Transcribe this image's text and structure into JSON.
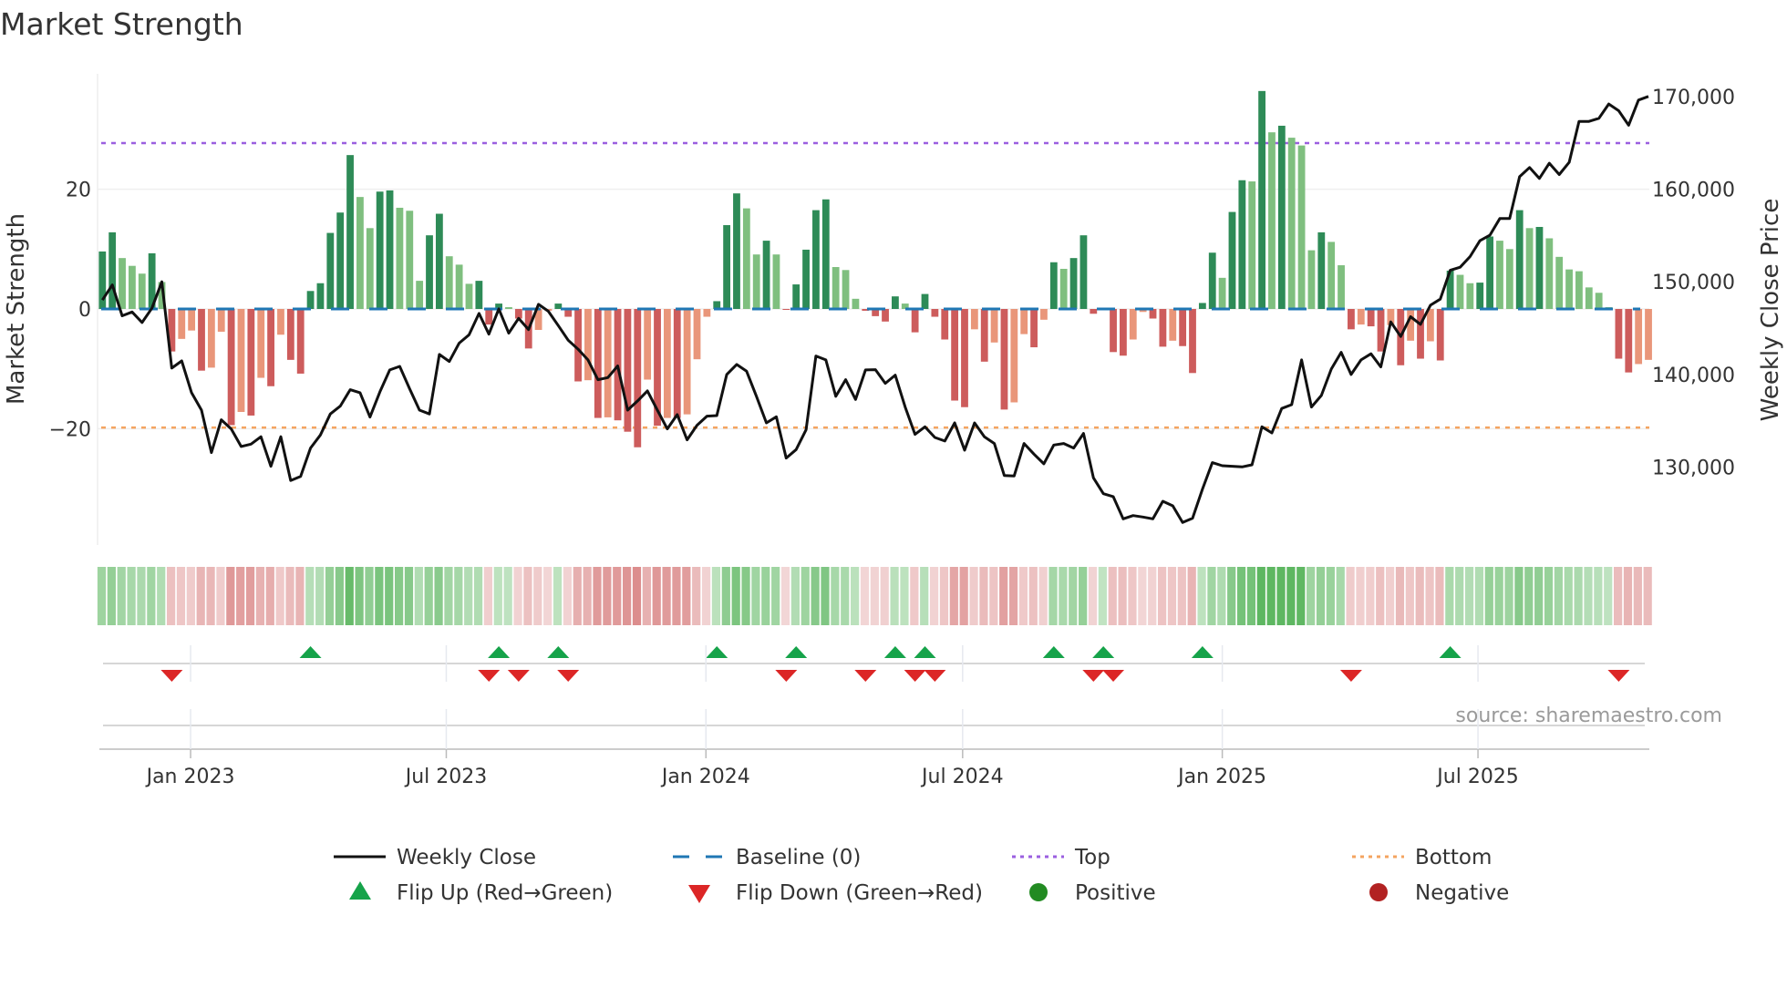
{
  "chart_data": {
    "type": "bar",
    "title": "Market Strength",
    "ylabel": "Market Strength",
    "y2label": "Weekly Close Price",
    "ylim": [
      -31,
      38
    ],
    "y2lim": [
      122000,
      173000
    ],
    "y_ticks": [
      {
        "value": 20,
        "label": "20"
      },
      {
        "value": 0,
        "label": "0"
      },
      {
        "value": -20,
        "label": "−20"
      }
    ],
    "y2_ticks": [
      {
        "value": 170000,
        "label": "170,000"
      },
      {
        "value": 160000,
        "label": "160,000"
      },
      {
        "value": 150000,
        "label": "150,000"
      },
      {
        "value": 140000,
        "label": "140,000"
      },
      {
        "value": 130000,
        "label": "130,000"
      }
    ],
    "x_ticks": [
      {
        "index": 8.9,
        "label": "Jan 2023"
      },
      {
        "index": 34.7,
        "label": "Jul 2023"
      },
      {
        "index": 60.9,
        "label": "Jan 2024"
      },
      {
        "index": 86.8,
        "label": "Jul 2024"
      },
      {
        "index": 113.0,
        "label": "Jan 2025"
      },
      {
        "index": 138.8,
        "label": "Jul 2025"
      }
    ],
    "top_level": 27.7,
    "bottom_level": -19.8,
    "baseline": 0,
    "strength": [
      9.6,
      12.8,
      8.5,
      7.2,
      5.9,
      9.3,
      4.5,
      -7.1,
      -5,
      -3.6,
      -10.3,
      -9.8,
      -3.8,
      -19.4,
      -17.2,
      -17.8,
      -11.5,
      -12.9,
      -4.3,
      -8.5,
      -10.8,
      3,
      4.3,
      12.7,
      16.1,
      25.7,
      18.7,
      13.5,
      19.6,
      19.8,
      16.9,
      16.4,
      4.7,
      12.3,
      15.9,
      8.8,
      7.4,
      4.2,
      4.7,
      -2.6,
      0.9,
      0.3,
      -1.6,
      -6.6,
      -3.5,
      -0.3,
      0.9,
      -1.3,
      -12.1,
      -11.9,
      -18.2,
      -18.1,
      -18.6,
      -20.5,
      -23.1,
      -11.8,
      -19.5,
      -18.2,
      -18.2,
      -17.6,
      -8.4,
      -1.3,
      1.3,
      14,
      19.3,
      16.8,
      9.1,
      11.4,
      9.1,
      -0.1,
      4.1,
      9.9,
      16.5,
      18.3,
      7,
      6.5,
      1.7,
      -0.3,
      -1.2,
      -2.1,
      2.1,
      0.9,
      -3.9,
      2.5,
      -1.3,
      -5.1,
      -15.3,
      -16.4,
      -3.4,
      -8.8,
      -5.6,
      -16.8,
      -15.6,
      -4.2,
      -6.4,
      -1.8,
      7.8,
      6.7,
      8.5,
      12.3,
      -0.8,
      0.2,
      -7.2,
      -7.8,
      -5.1,
      -0.5,
      -1.6,
      -6.3,
      -5.3,
      -6.2,
      -10.7,
      1,
      9.4,
      5.2,
      16.2,
      21.5,
      21.3,
      36.4,
      29.5,
      30.6,
      28.6,
      27.3,
      9.8,
      12.8,
      11.2,
      7.3,
      -3.4,
      -2.6,
      -2.9,
      -7.1,
      -2.7,
      -9.4,
      -5.3,
      -8.3,
      -5.4,
      -8.6,
      6.4,
      5.7,
      4.3,
      4.4,
      12.1,
      11.4,
      10,
      16.5,
      13.5,
      13.7,
      11.8,
      8.7,
      6.6,
      6.3,
      3.6,
      2.7,
      0.3,
      -8.3,
      -10.6,
      -9.2,
      -8.5
    ],
    "weekly_close": [
      148033,
      149670,
      146330,
      146750,
      145600,
      147150,
      150000,
      140690,
      141470,
      138030,
      136160,
      131570,
      135110,
      134130,
      132230,
      132490,
      133280,
      130100,
      133280,
      128560,
      129010,
      132060,
      133470,
      135740,
      136590,
      138360,
      138030,
      135410,
      138130,
      140490,
      140880,
      138460,
      136160,
      135740,
      142160,
      141410,
      143380,
      144290,
      146590,
      144360,
      147080,
      144460,
      146060,
      144850,
      147570,
      146820,
      145280,
      143700,
      142720,
      141570,
      139440,
      139670,
      140920,
      136160,
      137150,
      138230,
      136160,
      134130,
      135670,
      132950,
      134520,
      135510,
      135570,
      140000,
      141080,
      140360,
      137640,
      134780,
      135440,
      130980,
      131900,
      134030,
      142000,
      141570,
      137640,
      139440,
      137310,
      140490,
      140520,
      139050,
      139930,
      136490,
      133540,
      134360,
      133210,
      132820,
      134780,
      131830,
      134780,
      133280,
      132560,
      129110,
      129050,
      132560,
      131410,
      130360,
      132390,
      132560,
      132060,
      133640,
      128850,
      127140,
      126820,
      124420,
      124780,
      124620,
      124420,
      126320,
      125830,
      124030,
      124490,
      127640,
      130490,
      130160,
      130100,
      130030,
      130260,
      134360,
      133700,
      136330,
      136750,
      141570,
      136490,
      137740,
      140590,
      142390,
      140000,
      141570,
      142230,
      140820,
      145670,
      144100,
      146230,
      145410,
      147470,
      148130,
      151240,
      151570,
      152720,
      154430,
      155020,
      156820,
      156820,
      161340,
      162330,
      161150,
      162790,
      161570,
      162890,
      167310,
      167310,
      167640,
      169180,
      168460,
      166890,
      169610,
      170000
    ],
    "legend": [
      {
        "label": "Weekly Close",
        "symbol": "line"
      },
      {
        "label": "Baseline (0)",
        "symbol": "dash"
      },
      {
        "label": "Top",
        "symbol": "dot-purple"
      },
      {
        "label": "Bottom",
        "symbol": "dot-orange"
      },
      {
        "label": "Flip Up (Red→Green)",
        "symbol": "triangle-up"
      },
      {
        "label": "Flip Down (Green→Red)",
        "symbol": "triangle-down"
      },
      {
        "label": "Positive",
        "symbol": "circle-green"
      },
      {
        "label": "Negative",
        "symbol": "circle-red"
      }
    ],
    "legend_position": "bottom-center",
    "source": "source: sharemaestro.com"
  },
  "colors": {
    "pos_strong": "#2e8b57",
    "pos_weak": "#7fbf7f",
    "neg_strong": "#cd5c5c",
    "neg_weak": "#e9967a",
    "line": "#111111",
    "baseline": "#1f77b4",
    "top": "#9b5fe0",
    "bottom": "#f4a460",
    "flip_up": "#16a34a",
    "flip_down": "#dc2626",
    "positive": "#228b22",
    "negative": "#b22222"
  }
}
